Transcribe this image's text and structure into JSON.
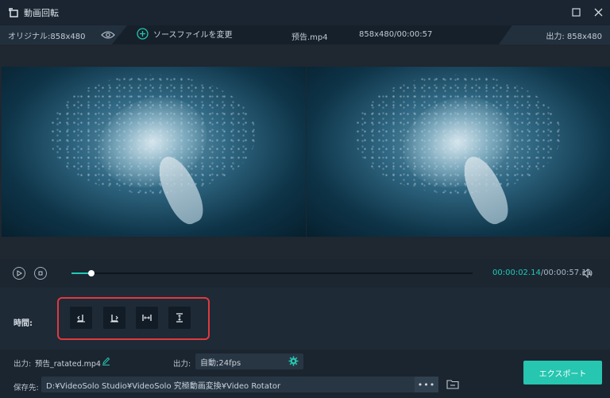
{
  "window": {
    "title": "動画回転",
    "icons": [
      "rotate-app-icon",
      "minimize-icon",
      "maximize-icon",
      "close-icon"
    ]
  },
  "infobar": {
    "original_label": "オリジナル:858x480",
    "change_source_label": "ソースファイルを変更",
    "filename": "预告.mp4",
    "resolution_duration": "858x480/00:00:57",
    "output_label": "出力: 858x480"
  },
  "playback": {
    "current_time": "00:00:02.14",
    "total_time": "/00:00:57.11",
    "progress": 0.05
  },
  "rotate": {
    "label": "時間:",
    "buttons": [
      "rotate-left-icon",
      "rotate-right-icon",
      "flip-horizontal-icon",
      "flip-vertical-icon"
    ]
  },
  "output": {
    "file_label": "出力:",
    "file_name": "预告_ratated.mp4",
    "format_label": "出力:",
    "format_value": "自動;24fps",
    "save_label": "保存先:",
    "save_path": "D:¥VideoSolo Studio¥VideoSolo 究極動画変換¥Video Rotator",
    "more_label": "•••",
    "export_label": "エクスポート"
  },
  "colors": {
    "accent": "#26c6b0",
    "highlight_border": "#e0393e",
    "background": "#1e2a36"
  }
}
